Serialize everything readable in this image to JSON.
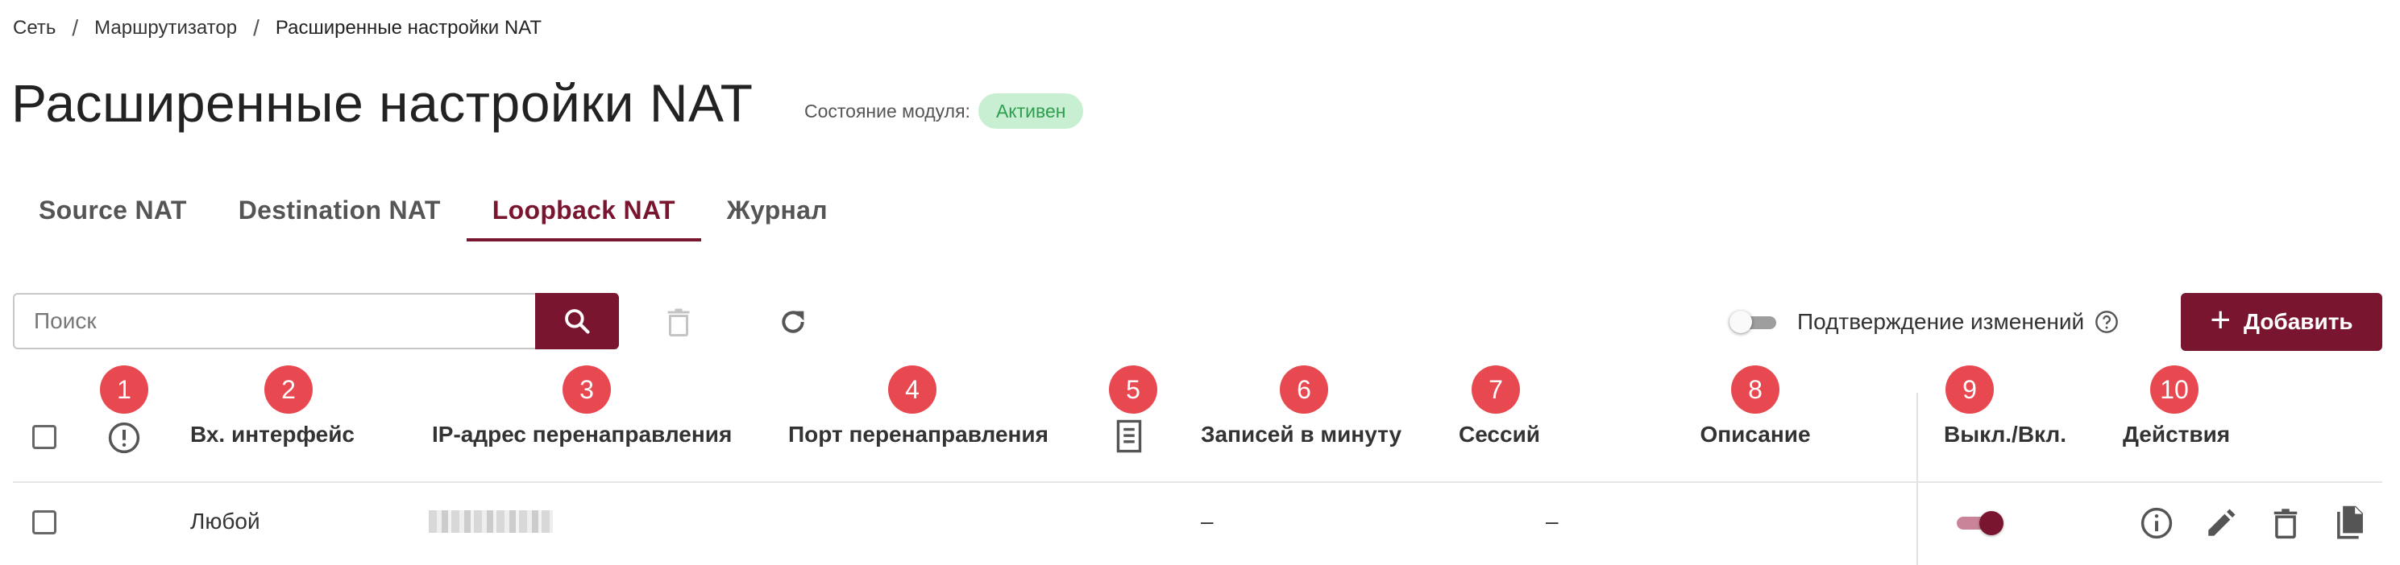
{
  "breadcrumb": {
    "items": [
      "Сеть",
      "Маршрутизатор",
      "Расширенные настройки NAT"
    ],
    "separator": "/"
  },
  "page": {
    "title": "Расширенные настройки NAT",
    "status_label": "Состояние модуля:",
    "status_value": "Активен"
  },
  "tabs": [
    {
      "label": "Source NAT",
      "active": false
    },
    {
      "label": "Destination NAT",
      "active": false
    },
    {
      "label": "Loopback NAT",
      "active": true
    },
    {
      "label": "Журнал",
      "active": false
    }
  ],
  "toolbar": {
    "search_placeholder": "Поиск",
    "search_icon": "search-icon",
    "delete_icon": "trash-icon",
    "refresh_icon": "refresh-icon",
    "confirm_label": "Подтверждение изменений",
    "confirm_enabled": false,
    "add_label": "Добавить"
  },
  "table": {
    "markers": [
      "1",
      "2",
      "3",
      "4",
      "5",
      "6",
      "7",
      "8",
      "9",
      "10"
    ],
    "headers": {
      "alert_icon": "alert-circle-icon",
      "interface": "Вх. интерфейс",
      "ip": "IP-адрес перенаправления",
      "port": "Порт перенаправления",
      "log_icon": "document-icon",
      "records": "Записей в минуту",
      "sessions": "Сессий",
      "description": "Описание",
      "toggle": "Выкл./Вкл.",
      "actions": "Действия"
    },
    "rows": [
      {
        "interface": "Любой",
        "ip": "",
        "port": "",
        "records": "–",
        "sessions": "–",
        "description": "",
        "enabled": true,
        "actions": [
          "info-icon",
          "edit-icon",
          "trash-icon",
          "copy-icon"
        ]
      }
    ]
  },
  "colors": {
    "accent": "#7a1530",
    "marker": "#e84850",
    "badge_bg": "#c9efd3",
    "badge_text": "#2e9e4f"
  }
}
